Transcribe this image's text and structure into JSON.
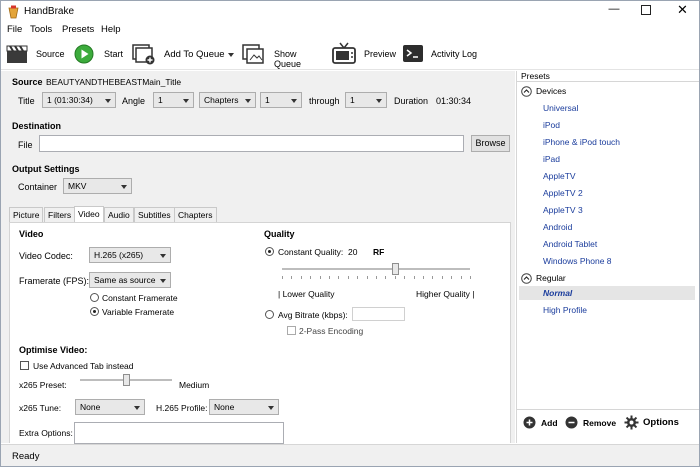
{
  "app": {
    "title": "HandBrake"
  },
  "menu": [
    "File",
    "Tools",
    "Presets",
    "Help"
  ],
  "toolbar": {
    "source": "Source",
    "start": "Start",
    "add_to_queue": "Add To Queue",
    "show_queue": "Show Queue",
    "preview": "Preview",
    "activity_log": "Activity Log"
  },
  "source": {
    "label": "Source",
    "value": "BEAUTYANDTHEBEASTMain_Title",
    "title_label": "Title",
    "title_value": "1 (01:30:34)",
    "angle_label": "Angle",
    "angle_value": "1",
    "range_type": "Chapters",
    "range_start": "1",
    "through_label": "through",
    "range_end": "1",
    "duration_label": "Duration",
    "duration_value": "01:30:34"
  },
  "destination": {
    "label": "Destination",
    "file_label": "File",
    "file_value": "",
    "browse": "Browse"
  },
  "output": {
    "label": "Output Settings",
    "container_label": "Container",
    "container_value": "MKV"
  },
  "tabs": [
    "Picture",
    "Filters",
    "Video",
    "Audio",
    "Subtitles",
    "Chapters"
  ],
  "video": {
    "section": "Video",
    "codec_label": "Video Codec:",
    "codec_value": "H.265 (x265)",
    "framerate_label": "Framerate (FPS):",
    "framerate_value": "Same as source",
    "constant_framerate": "Constant Framerate",
    "variable_framerate": "Variable Framerate",
    "quality_section": "Quality",
    "constant_quality_label": "Constant Quality:",
    "constant_quality_value": "20",
    "rf": "RF",
    "lower_quality": "| Lower Quality",
    "higher_quality": "Higher Quality |",
    "quality_fraction": 0.6,
    "avg_bitrate_label": "Avg Bitrate (kbps):",
    "avg_bitrate_value": "",
    "two_pass": "2-Pass Encoding",
    "optimise_section": "Optimise Video:",
    "advanced_tab": "Use Advanced Tab instead",
    "preset_label": "x265 Preset:",
    "preset_value": "Medium",
    "preset_fraction": 0.5,
    "tune_label": "x265 Tune:",
    "tune_value": "None",
    "profile_label": "H.265 Profile:",
    "profile_value": "None",
    "extra_label": "Extra Options:",
    "extra_value": ""
  },
  "presets": {
    "header": "Presets",
    "group_devices": "Devices",
    "devices": [
      "Universal",
      "iPod",
      "iPhone & iPod touch",
      "iPad",
      "AppleTV",
      "AppleTV 2",
      "AppleTV 3",
      "Android",
      "Android Tablet",
      "Windows Phone 8"
    ],
    "group_regular": "Regular",
    "regular": [
      "Normal",
      "High Profile"
    ],
    "add": "Add",
    "remove": "Remove",
    "options": "Options"
  },
  "status": "Ready"
}
